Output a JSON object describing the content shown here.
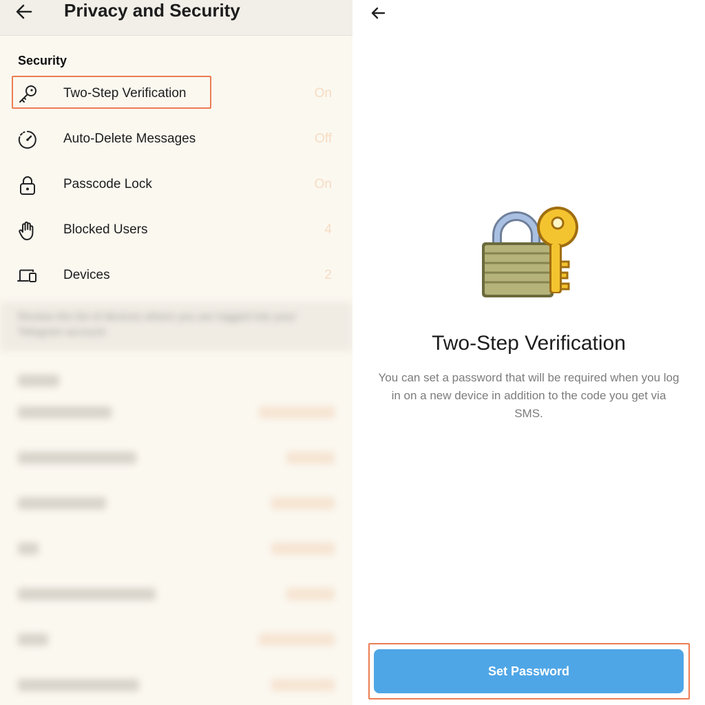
{
  "left": {
    "header": {
      "title": "Privacy and Security"
    },
    "security": {
      "section_title": "Security",
      "items": [
        {
          "label": "Two-Step Verification",
          "value": "On",
          "icon": "key-icon"
        },
        {
          "label": "Auto-Delete Messages",
          "value": "Off",
          "icon": "timer-icon"
        },
        {
          "label": "Passcode Lock",
          "value": "On",
          "icon": "lock-icon"
        },
        {
          "label": "Blocked Users",
          "value": "4",
          "icon": "hand-icon"
        },
        {
          "label": "Devices",
          "value": "2",
          "icon": "devices-icon"
        }
      ],
      "footer_note": "Review the list of devices where you are logged into your Telegram account."
    }
  },
  "right": {
    "title": "Two-Step Verification",
    "description": "You can set a password that will be required when you log in on a new device in addition to the code you get via SMS.",
    "button_label": "Set Password"
  },
  "colors": {
    "highlight_border": "#ec7c53",
    "button_bg": "#4fa6e6",
    "value_text": "#f7dcc2"
  }
}
